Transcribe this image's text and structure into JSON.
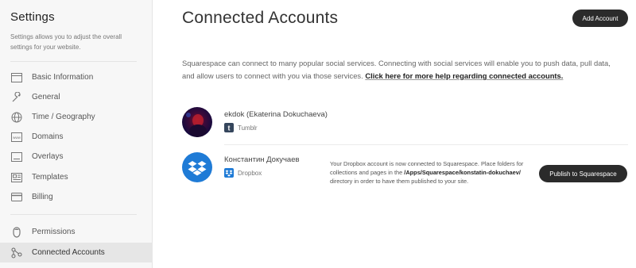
{
  "sidebar": {
    "title": "Settings",
    "description": "Settings allows you to adjust the overall settings for your website.",
    "items": [
      {
        "label": "Basic Information",
        "icon": "browser-window-icon"
      },
      {
        "label": "General",
        "icon": "wrench-icon"
      },
      {
        "label": "Time / Geography",
        "icon": "globe-icon"
      },
      {
        "label": "Domains",
        "icon": "www-icon"
      },
      {
        "label": "Overlays",
        "icon": "overlay-window-icon"
      },
      {
        "label": "Templates",
        "icon": "template-icon"
      },
      {
        "label": "Billing",
        "icon": "credit-card-icon"
      },
      {
        "label": "Permissions",
        "icon": "person-icon"
      },
      {
        "label": "Connected Accounts",
        "icon": "connected-nodes-icon",
        "active": true
      }
    ]
  },
  "main": {
    "title": "Connected Accounts",
    "add_account_label": "Add Account",
    "intro_text": "Squarespace can connect to many popular social services. Connecting with social services will enable you to push data, pull data, and allow users to connect with you via those services.",
    "intro_link": "Click here for more help regarding connected accounts.",
    "accounts": [
      {
        "name": "ekdok (Ekaterina Dokuchaeva)",
        "service": "Tumblr",
        "service_color": "#35465c"
      },
      {
        "name": "Константин Докучаев",
        "service": "Dropbox",
        "service_color": "#1f7bd6",
        "note_before": "Your Dropbox account is now connected to Squarespace. Place folders for collections and pages in the",
        "note_path": "/Apps/Squarespace/konstatin-dokuchaev/",
        "note_after": "directory in order to have them published to your site.",
        "publish_label": "Publish to Squarespace"
      }
    ]
  },
  "colors": {
    "sidebar_bg": "#f7f7f7",
    "active_item_bg": "#e6e6e6",
    "button_bg": "#2b2b2b",
    "dropbox_blue": "#1f7bd6",
    "tumblr_navy": "#35465c"
  }
}
